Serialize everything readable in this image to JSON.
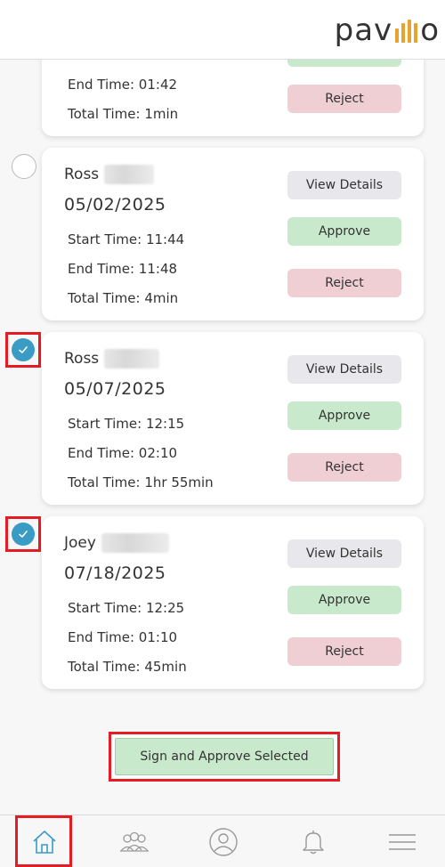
{
  "header": {
    "logo_text_left": "pav",
    "logo_text_right": "o"
  },
  "cards": [
    {
      "end_time": "End Time: 01:42",
      "total_time": "Total Time: 1min",
      "reject_label": "Reject"
    },
    {
      "name": "Ross",
      "date": "05/02/2025",
      "start_time": "Start Time: 11:44",
      "end_time": "End Time: 11:48",
      "total_time": "Total Time: 4min",
      "view_label": "View Details",
      "approve_label": "Approve",
      "reject_label": "Reject",
      "selected": false
    },
    {
      "name": "Ross",
      "date": "05/07/2025",
      "start_time": "Start Time: 12:15",
      "end_time": "End Time: 02:10",
      "total_time": "Total Time: 1hr 55min",
      "view_label": "View Details",
      "approve_label": "Approve",
      "reject_label": "Reject",
      "selected": true
    },
    {
      "name": "Joey",
      "date": "07/18/2025",
      "start_time": "Start Time: 12:25",
      "end_time": "End Time: 01:10",
      "total_time": "Total Time: 45min",
      "view_label": "View Details",
      "approve_label": "Approve",
      "reject_label": "Reject",
      "selected": true
    }
  ],
  "actions": {
    "sign_approve_label": "Sign and Approve Selected"
  },
  "nav": {
    "items": [
      {
        "icon": "home-icon",
        "active": true
      },
      {
        "icon": "team-icon",
        "active": false
      },
      {
        "icon": "profile-icon",
        "active": false
      },
      {
        "icon": "bell-icon",
        "active": false
      },
      {
        "icon": "menu-icon",
        "active": false
      }
    ]
  },
  "colors": {
    "accent": "#3a9bc4",
    "logo_bars": "#e7a32b",
    "approve": "#c9e9cc",
    "reject": "#efcfd4",
    "view": "#e8e8ec",
    "highlight": "#e51c23"
  }
}
